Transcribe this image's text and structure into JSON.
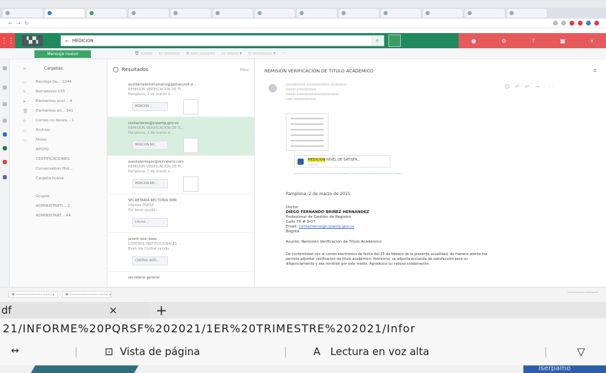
{
  "browser": {
    "tabs": [
      {
        "label": "",
        "color": "#9aa"
      },
      {
        "label": "",
        "color": "#2b7cd3"
      },
      {
        "label": "",
        "color": "#3aa567"
      },
      {
        "label": "",
        "color": "#9aa"
      },
      {
        "label": "",
        "color": "#9aa"
      },
      {
        "label": "",
        "color": "#9aa"
      },
      {
        "label": "",
        "color": "#9aa"
      },
      {
        "label": "",
        "color": "#9aa"
      },
      {
        "label": "",
        "color": "#9aa"
      },
      {
        "label": "",
        "color": "#9aa"
      },
      {
        "label": "",
        "color": "#9aa"
      },
      {
        "label": "",
        "color": "#9aa"
      },
      {
        "label": "",
        "color": "#9aa"
      }
    ]
  },
  "owa": {
    "search_query": "MEDICION",
    "new_message": "Mensaje nuevo"
  },
  "folders": {
    "header": "Carpetas",
    "items": [
      "Bandeja de... 1244",
      "Borradores 155",
      "Elementos envi... 4",
      "Elementos eli... 341",
      "Correo no desea... 1",
      "Archivo",
      "Notas",
      "APOYO",
      "CERTIFICACIONES",
      "Conversation Hist...",
      "Carpeta nueva",
      "Grupos",
      "ADMINISTRATI... 2",
      "ADMINISTRAT... 44"
    ]
  },
  "messages": {
    "header": "Resultados",
    "filter": "Filtro",
    "items": [
      {
        "from": "auxiliartalentohumano@gamacundi.e...",
        "subject": "REMISION VERIFICACION DE TI...",
        "preview": "Pamplona, 2 de marzo d...",
        "attachment": "MEDICION ...",
        "selected": false
      },
      {
        "from": "contactenos@ccpamp.gov.co",
        "subject": "REMISION VERIFICACION DE TI...",
        "preview": "Pamplona, 2 de marzo d...",
        "attachment": "MEDICION NIV...",
        "selected": true
      },
      {
        "from": "aseotalentogov@ministerio.com",
        "subject": "REMISION VERIFICACION DE TI...",
        "preview": "Pamplona, 2 de marzo d...",
        "attachment": "MEDICION NIV...",
        "selected": false
      },
      {
        "from": "SECRETARIA RECTORIA SMR",
        "subject": "Informe PQRSF",
        "preview": "Por favor ayuda...",
        "attachment": "Informe...",
        "selected": false
      },
      {
        "from": "janeth leon baez",
        "subject": "CONTROL INSTITUCIONALES",
        "preview": "Buen dia Cordial saludo...",
        "attachment": "CONTROL INSTI...",
        "selected": false
      },
      {
        "from": "secretaria general",
        "subject": "",
        "preview": "",
        "attachment": "",
        "selected": false
      }
    ]
  },
  "reading": {
    "title": "REMISION VERIFICACION DE TITULO ACADEMICO",
    "attachment_highlight": "MEDICION",
    "attachment_rest": " NIVEL DE SATISFA...",
    "date_line": "Pamplona, 2 de marzo de 2021",
    "salutation": "Doctor",
    "name": "DIEGO FERNANDO BRIÑEZ HERNANDEZ",
    "role": "Profesional de Gestión de Registro",
    "address": "Calle 76 # 9-07",
    "email_label": "Email:",
    "email": "contactenos@ccpamp.gov.co",
    "city": "Bogotá",
    "subject_line": "Asunto: Remisión Verificación de Título Académico",
    "body1": "De conformidad con el correo electrónico de fecha del 25 de febrero de la presente anualidad, de manera atenta me",
    "body2": "permito adjuntar verificación de título académico. Asimismo, se adjunta encuesta de satisfacción para su",
    "body3": "diligenciamiento y sea remitido por este medio. Agradezco su valiosa colaboración."
  },
  "edge": {
    "tab_label": "df",
    "tab_close": "×",
    "new_tab": "+",
    "address": "21/INFORME%20PQRSF%202021/1ER%20TRIMESTRE%202021/Infor",
    "fit_icon": "↔",
    "page_view_icon": "⊡",
    "page_view": "Vista de página",
    "read_aloud_icon": "A",
    "read_aloud": "Lectura en voz alta",
    "draw_icon": "▽",
    "corner_text": "iserpamo"
  }
}
